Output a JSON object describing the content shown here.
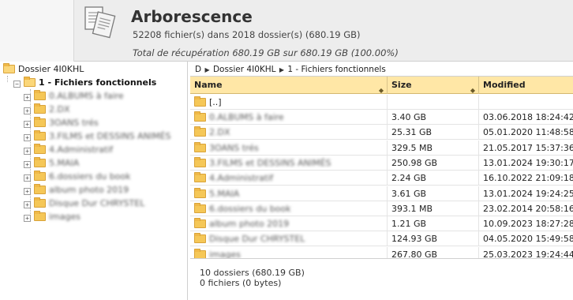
{
  "header": {
    "title": "Arborescence",
    "subtitle": "52208 fichier(s) dans 2018 dossier(s) (680.19 GB)",
    "recovery": "Total de récupération 680.19 GB sur 680.19 GB (100.00%)",
    "icon": "documents-icon"
  },
  "tree": {
    "root_label": "Dossier 4I0KHL",
    "selected_label": "1 - Fichiers fonctionnels",
    "children": [
      {
        "label": "0.ALBUMS à faire"
      },
      {
        "label": "2.DX"
      },
      {
        "label": "3OANS trés"
      },
      {
        "label": "3.FILMS et DESSINS ANIMÉS"
      },
      {
        "label": "4.Administratif"
      },
      {
        "label": "5.MAIA"
      },
      {
        "label": "6.dossiers du book"
      },
      {
        "label": "album photo 2019"
      },
      {
        "label": "Disque Dur CHRYSTEL"
      },
      {
        "label": "images"
      }
    ]
  },
  "breadcrumb": {
    "drive": "D",
    "folder": "Dossier 4I0KHL",
    "current": "1 - Fichiers fonctionnels"
  },
  "table": {
    "columns": {
      "name": "Name",
      "size": "Size",
      "modified": "Modified"
    },
    "parent_row": "[..]",
    "rows": [
      {
        "name": "0.ALBUMS à faire",
        "size": "3.40 GB",
        "modified": "03.06.2018 18:24:42"
      },
      {
        "name": "2.DX",
        "size": "25.31 GB",
        "modified": "05.01.2020 11:48:58"
      },
      {
        "name": "3OANS trés",
        "size": "329.5 MB",
        "modified": "21.05.2017 15:37:36"
      },
      {
        "name": "3.FILMS et DESSINS ANIMÉS",
        "size": "250.98 GB",
        "modified": "13.01.2024 19:30:17"
      },
      {
        "name": "4.Administratif",
        "size": "2.24 GB",
        "modified": "16.10.2022 21:09:18"
      },
      {
        "name": "5.MAIA",
        "size": "3.61 GB",
        "modified": "13.01.2024 19:24:25"
      },
      {
        "name": "6.dossiers du book",
        "size": "393.1 MB",
        "modified": "23.02.2014 20:58:16"
      },
      {
        "name": "album photo 2019",
        "size": "1.21 GB",
        "modified": "10.09.2023 18:27:28"
      },
      {
        "name": "Disque Dur CHRYSTEL",
        "size": "124.93 GB",
        "modified": "04.05.2020 15:49:58"
      },
      {
        "name": "images",
        "size": "267.80 GB",
        "modified": "25.03.2023 19:24:44"
      }
    ]
  },
  "footer": {
    "folders": "10 dossiers (680.19 GB)",
    "files": "0 fichiers (0 bytes)"
  },
  "colors": {
    "header_bg": "#ededed",
    "table_header_bg": "#ffe7a6",
    "folder": "#f5c757"
  }
}
